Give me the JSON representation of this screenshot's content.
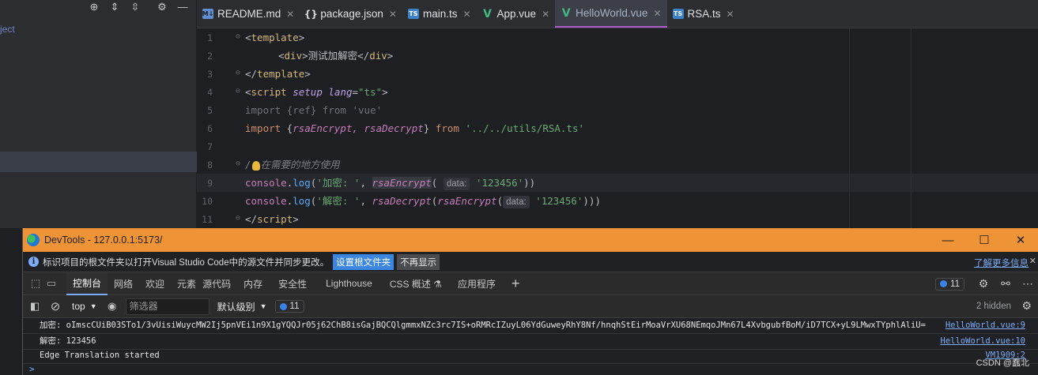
{
  "ide": {
    "project_label": "ject",
    "tabs": [
      {
        "label": "README.md",
        "type": "md",
        "icon": "M↓"
      },
      {
        "label": "package.json",
        "type": "js",
        "icon": "{}"
      },
      {
        "label": "main.ts",
        "type": "ts",
        "icon": "TS"
      },
      {
        "label": "App.vue",
        "type": "vue",
        "icon": "V"
      },
      {
        "label": "HelloWorld.vue",
        "type": "vue",
        "icon": "V",
        "active": true
      },
      {
        "label": "RSA.ts",
        "type": "ts",
        "icon": "TS"
      }
    ],
    "line_numbers": [
      "1",
      "2",
      "3",
      "4",
      "5",
      "6",
      "7",
      "8",
      "9",
      "10",
      "11"
    ],
    "code": {
      "l1_tag": "template",
      "l2_tag_open": "div",
      "l2_text": "测试加解密",
      "l2_tag_close": "div",
      "l3_tag": "template",
      "l4_tag": "script",
      "l4_setup": "setup",
      "l4_attr": "lang",
      "l4_val": "\"ts\"",
      "l5_import": "import",
      "l5_ref": "{ref}",
      "l5_from": "from",
      "l5_str": "'vue'",
      "l6_import": "import",
      "l6_names": "rsaEncrypt, rsaDecrypt",
      "l6_from": "from",
      "l6_str": "'../../utils/RSA.ts'",
      "l8_comment": "在需要的地方使用",
      "l9_console": "console",
      "l9_log": "log",
      "l9_str": "'加密: '",
      "l9_fn": "rsaEncrypt",
      "l9_hint": "data:",
      "l9_arg": "'123456'",
      "l10_console": "console",
      "l10_log": "log",
      "l10_str": "'解密: '",
      "l10_fn1": "rsaDecrypt",
      "l10_fn2": "rsaEncrypt",
      "l10_hint": "data:",
      "l10_arg": "'123456'",
      "l11_tag": "script"
    }
  },
  "devtools": {
    "title": "DevTools - 127.0.0.1:5173/",
    "window_controls": {
      "minimize": "—",
      "maximize": "☐",
      "close": "✕"
    },
    "infobar": {
      "text": "标识项目的根文件夹以打开Visual Studio Code中的源文件并同步更改。",
      "primary_button": "设置根文件夹",
      "secondary_button": "不再显示",
      "link": "了解更多信息",
      "close": "✕"
    },
    "tabs": [
      "控制台",
      "网络",
      "欢迎",
      "元素",
      "源代码",
      "内存",
      "安全性",
      "Lighthouse",
      "CSS 概述 ⚗",
      "应用程序"
    ],
    "active_tab": "控制台",
    "add_tab": "+",
    "message_count": "11",
    "toolbar": {
      "context": "top",
      "filter_placeholder": "筛选器",
      "levels": "默认级别",
      "issues_count": "11",
      "hidden": "2 hidden"
    },
    "logs": [
      {
        "message": "加密:  oImscCUiB03STo1/3vUisiWuycMW2Ij5pnVEi1n9X1gYQQJr05j62ChB8isGajBQCQlgmmxNZc3rc7IS+oRMRcIZuyL06YdGuweyRhY8Nf/hnqhStEirMoaVrXU68NEmqoJMn67L4XvbgubfBoM/iD7TCX+yL9LMwxTYphlAliU=",
        "source": "HelloWorld.vue:9"
      },
      {
        "message": "解密:  123456",
        "source": "HelloWorld.vue:10"
      },
      {
        "message": "Edge Translation started",
        "source": "VM1909:2"
      }
    ],
    "prompt": ">",
    "watermark": "CSDN @蠢北"
  }
}
